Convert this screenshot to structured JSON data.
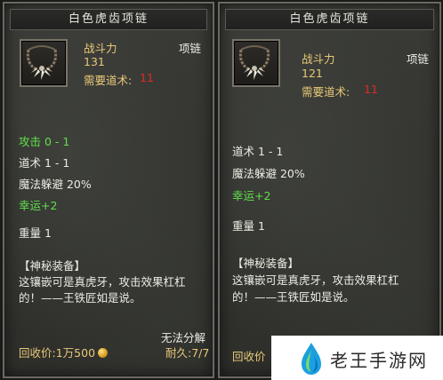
{
  "left": {
    "title": "白色虎齿项链",
    "icon": "tiger-tooth-necklace-icon",
    "power_label": "战斗力",
    "power_value": "131",
    "type": "项链",
    "req_label": "需要道术:",
    "req_value": "11",
    "stats": {
      "attack": "攻击 0 - 1",
      "taoism": "道术 1 - 1",
      "magic_dodge": "魔法躲避 20%",
      "luck": "幸运+2",
      "weight": "重量 1"
    },
    "desc_title": "【神秘装备】",
    "desc_line1": "这镶嵌可是真虎牙，攻击效果杠杠",
    "desc_line2": "的！——王铁匠如是说。",
    "no_decompose": "无法分解",
    "price_label": "回收价:",
    "price_value": "1万500",
    "durability_label": "耐久:",
    "durability_value": "7/7"
  },
  "right": {
    "title": "白色虎齿项链",
    "icon": "tiger-tooth-necklace-icon",
    "power_label": "战斗力",
    "power_value": "121",
    "type": "项链",
    "req_label": "需要道术:",
    "req_value": "11",
    "stats": {
      "taoism": "道术 1 - 1",
      "magic_dodge": "魔法躲避 20%",
      "luck": "幸运+2",
      "weight": "重量 1"
    },
    "desc_title": "【神秘装备】",
    "desc_line1": "这镶嵌可是真虎牙，攻击效果杠杠",
    "desc_line2": "的！——王铁匠如是说。",
    "price_label": "回收价"
  },
  "watermark": {
    "text": "老王手游网"
  },
  "colors": {
    "gold": "#e8c878",
    "green": "#5ee04a",
    "red": "#e02a20",
    "panel": "#343531"
  }
}
